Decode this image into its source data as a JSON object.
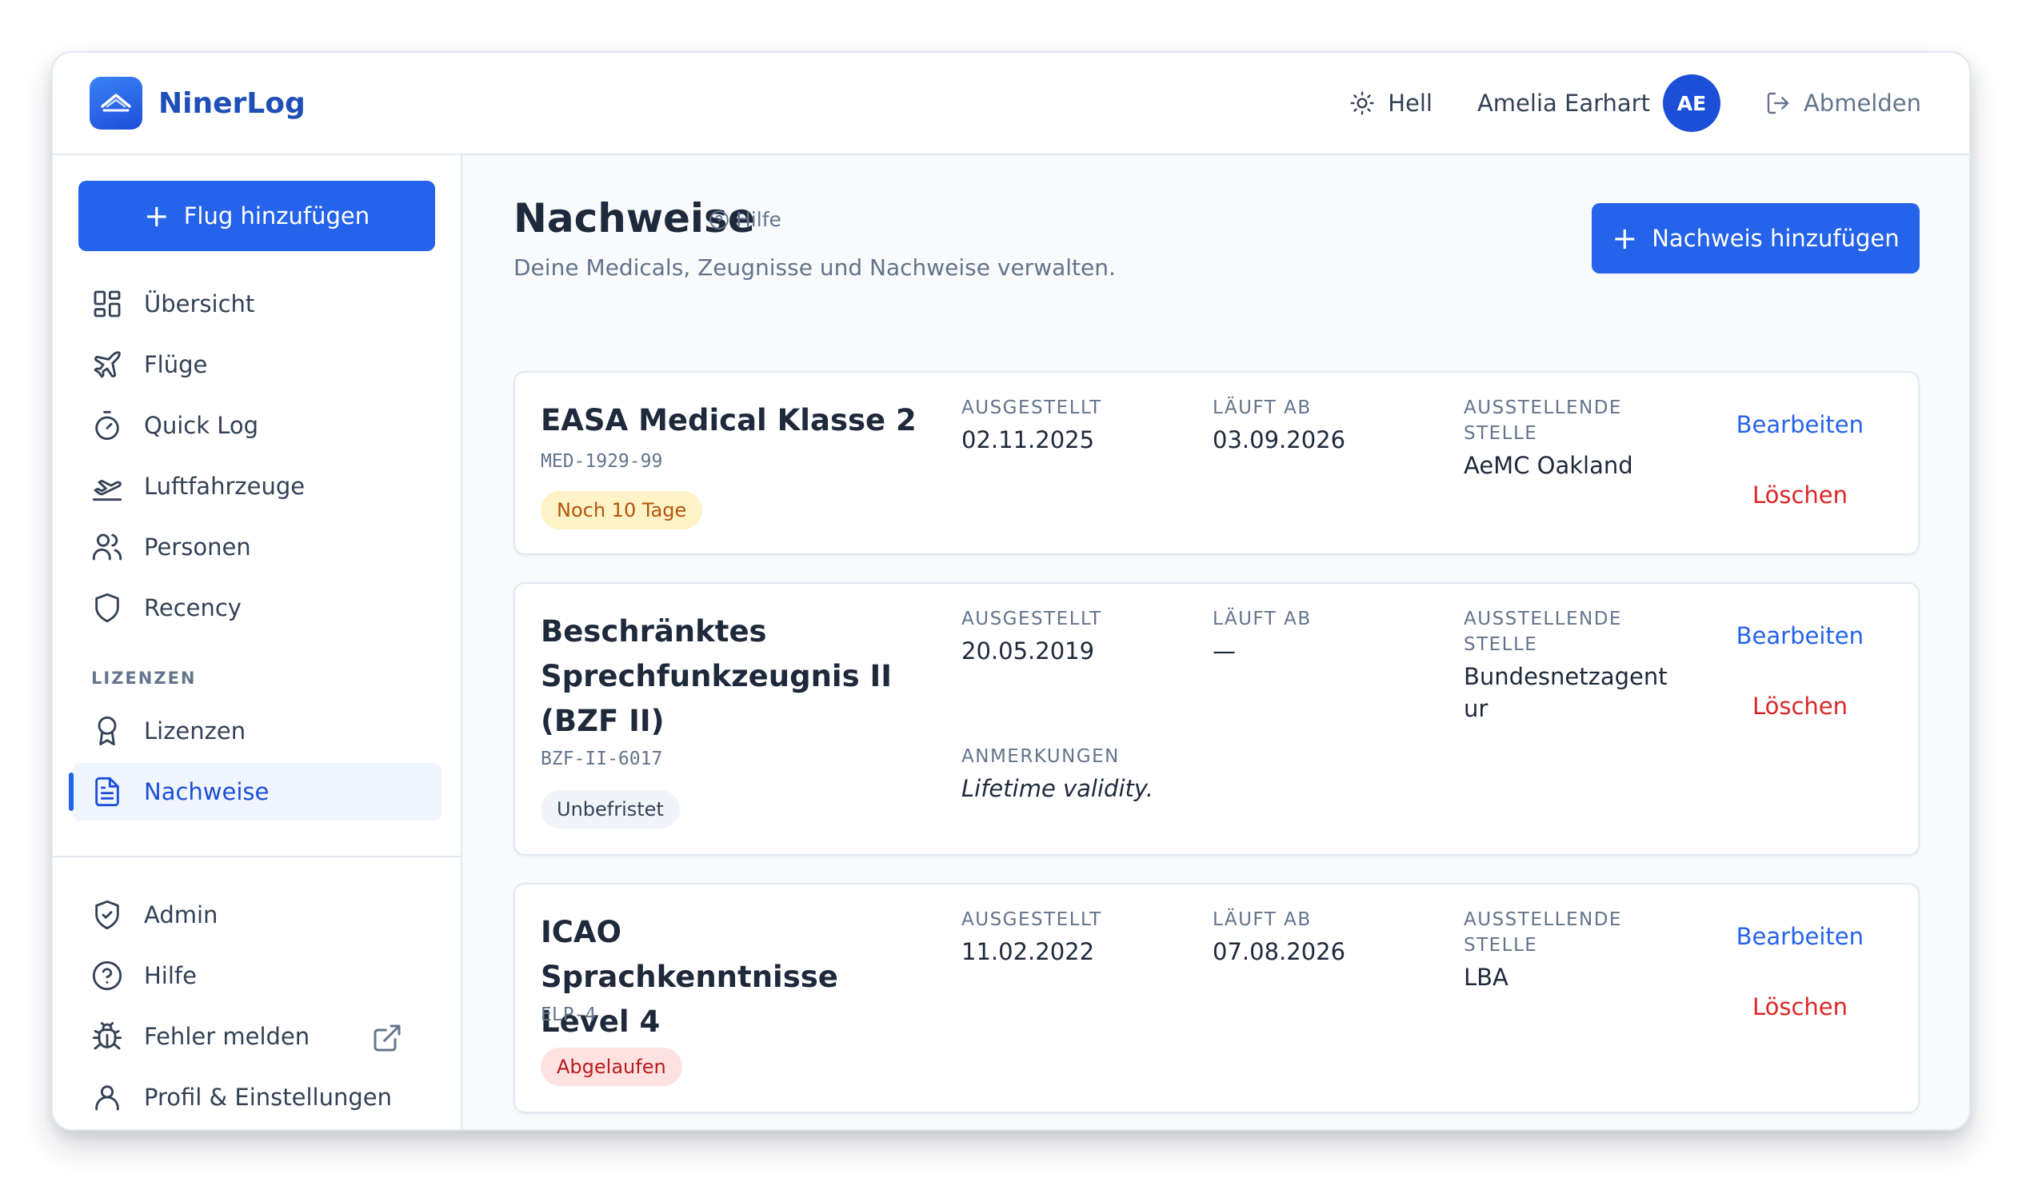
{
  "app": {
    "name": "NinerLog"
  },
  "header": {
    "theme_label": "Hell",
    "user_name": "Amelia Earhart",
    "user_initials": "AE",
    "logout_label": "Abmelden"
  },
  "sidebar": {
    "add_flight_label": "Flug hinzufügen",
    "items": [
      {
        "label": "Übersicht",
        "icon": "dashboard-icon"
      },
      {
        "label": "Flüge",
        "icon": "plane-icon"
      },
      {
        "label": "Quick Log",
        "icon": "timer-icon"
      },
      {
        "label": "Luftfahrzeuge",
        "icon": "plane-takeoff-icon"
      },
      {
        "label": "Personen",
        "icon": "users-icon"
      },
      {
        "label": "Recency",
        "icon": "shield-icon"
      }
    ],
    "section_label": "LIZENZEN",
    "license_items": [
      {
        "label": "Lizenzen",
        "icon": "award-icon"
      },
      {
        "label": "Nachweise",
        "icon": "document-icon",
        "active": true
      }
    ],
    "bottom_items": [
      {
        "label": "Admin",
        "icon": "shield-check-icon"
      },
      {
        "label": "Hilfe",
        "icon": "help-circle-icon"
      },
      {
        "label": "Fehler melden",
        "icon": "bug-icon"
      },
      {
        "label": "Profil & Einstellungen",
        "icon": "user-icon"
      }
    ]
  },
  "main": {
    "title": "Nachweise",
    "help_label": "Hilfe",
    "subtitle": "Deine Medicals, Zeugnisse und Nachweise verwalten.",
    "add_label": "Nachweis hinzufügen",
    "labels": {
      "issued": "AUSGESTELLT",
      "expires": "LÄUFT AB",
      "authority_line1": "AUSSTELLENDE",
      "authority_line2": "STELLE",
      "remarks": "ANMERKUNGEN",
      "edit": "Bearbeiten",
      "delete": "Löschen"
    },
    "certificates": [
      {
        "title": "EASA Medical Klasse 2",
        "code": "MED-1929-99",
        "issued": "02.11.2025",
        "expires": "03.09.2026",
        "authority": "AeMC Oakland",
        "badge": "Noch 10 Tage",
        "badge_status": "warning"
      },
      {
        "title": "Beschränktes Sprechfunkzeugnis II (BZF II)",
        "code": "BZF-II-6017",
        "issued": "20.05.2019",
        "expires": "—",
        "authority": "Bundesnetzagentur",
        "remarks": "Lifetime validity.",
        "badge": "Unbefristet",
        "badge_status": "neutral"
      },
      {
        "title": "ICAO Sprachkenntnisse Level 4",
        "code": "ELP-4",
        "issued": "11.02.2022",
        "expires": "07.08.2026",
        "authority": "LBA",
        "badge": "Abgelaufen",
        "badge_status": "danger"
      }
    ]
  },
  "colors": {
    "primary": "#2563eb",
    "brand": "#1e4fb8",
    "danger": "#dc2626",
    "warning_bg": "#fef3c7",
    "danger_bg": "#fee2e2"
  }
}
